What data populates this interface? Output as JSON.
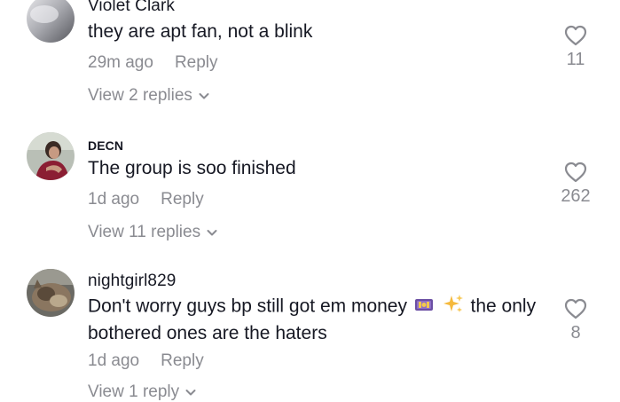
{
  "comments": [
    {
      "username": "Violet Clark",
      "text": "they are apt fan, not a blink",
      "time": "29m ago",
      "reply_label": "Reply",
      "view_replies": "View 2 replies",
      "likes": "11",
      "heart_icon": "heart-outline-icon"
    },
    {
      "username": "DECN",
      "text": "The group is soo finished",
      "time": "1d ago",
      "reply_label": "Reply",
      "view_replies": "View 11 replies",
      "likes": "262",
      "heart_icon": "heart-outline-icon"
    },
    {
      "username": "nightgirl829",
      "text_before": "Don't worry guys bp still got em money",
      "emojis": [
        "money-with-wings-emoji",
        "sparkles-emoji"
      ],
      "text_after": "the only bothered ones are the haters",
      "time": "1d ago",
      "reply_label": "Reply",
      "view_replies": "View 1 reply",
      "likes": "8",
      "heart_icon": "heart-outline-icon"
    }
  ],
  "colors": {
    "primary_text": "#161823",
    "secondary_text": "#8a8b91",
    "background": "#ffffff"
  }
}
